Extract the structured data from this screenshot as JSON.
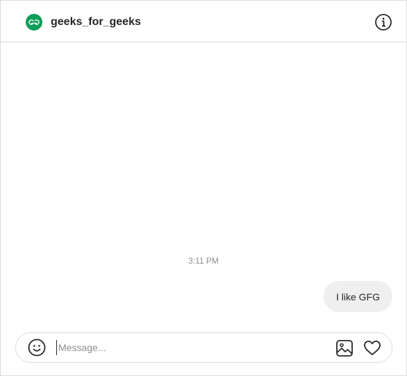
{
  "header": {
    "username": "geeks_for_geeks",
    "avatar_logo_text": "GG"
  },
  "conversation": {
    "timestamp": "3:11 PM",
    "messages": [
      {
        "text": "I like GFG",
        "sender": "me"
      }
    ]
  },
  "composer": {
    "placeholder": "Message...",
    "value": ""
  },
  "icons": {
    "info": "info-icon",
    "emoji": "emoji-icon",
    "image": "image-icon",
    "heart": "heart-icon"
  },
  "colors": {
    "brand": "#0f9d58",
    "bubble": "#efefef",
    "border": "#dbdbdb",
    "muted_text": "#8e8e8e"
  }
}
